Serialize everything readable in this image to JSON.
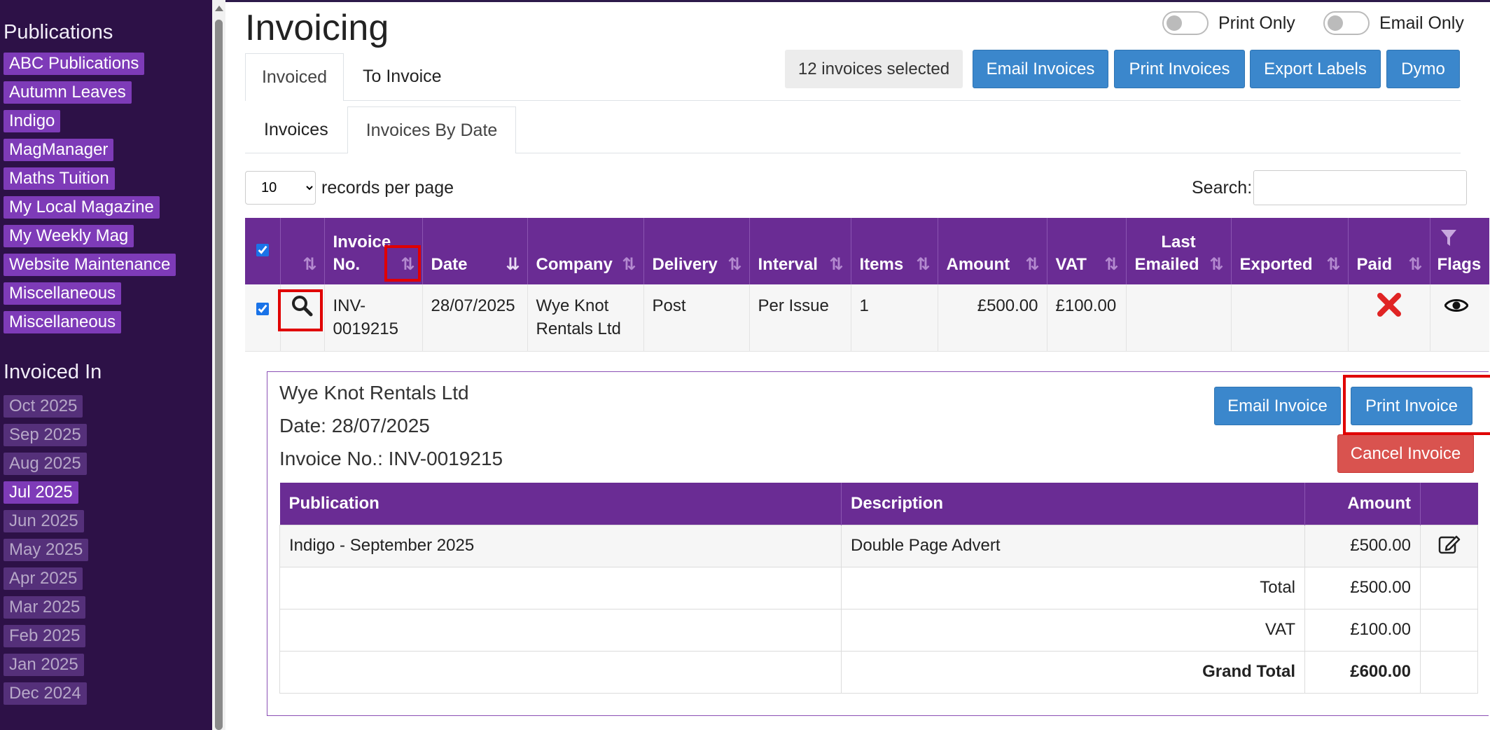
{
  "sidebar": {
    "publications_heading": "Publications",
    "publications": [
      "ABC Publications",
      "Autumn Leaves",
      "Indigo",
      "MagManager",
      "Maths Tuition",
      "My Local Magazine",
      "My Weekly Mag",
      "Website Maintenance",
      "Miscellaneous",
      "Miscellaneous"
    ],
    "invoiced_in_heading": "Invoiced In",
    "months": [
      "Oct 2025",
      "Sep 2025",
      "Aug 2025",
      "Jul 2025",
      "Jun 2025",
      "May 2025",
      "Apr 2025",
      "Mar 2025",
      "Feb 2025",
      "Jan 2025",
      "Dec 2024"
    ],
    "active_month": "Jul 2025"
  },
  "header": {
    "title": "Invoicing",
    "print_only_label": "Print Only",
    "email_only_label": "Email Only",
    "selected_count": "12 invoices selected",
    "buttons": {
      "email_invoices": "Email Invoices",
      "print_invoices": "Print Invoices",
      "export_labels": "Export Labels",
      "dymo": "Dymo"
    }
  },
  "tabs_top": [
    {
      "label": "Invoiced",
      "active": true
    },
    {
      "label": "To Invoice",
      "active": false
    }
  ],
  "tabs_sub": [
    {
      "label": "Invoices",
      "active": false
    },
    {
      "label": "Invoices By Date",
      "active": true
    }
  ],
  "records": {
    "value": "10",
    "label": "records per page"
  },
  "search": {
    "label": "Search:",
    "value": ""
  },
  "table": {
    "columns": {
      "invoice_no_line1": "Invoice",
      "invoice_no_line2": "No.",
      "date": "Date",
      "company": "Company",
      "delivery": "Delivery",
      "interval": "Interval",
      "items": "Items",
      "amount": "Amount",
      "vat": "VAT",
      "last_emailed_line1": "Last",
      "last_emailed_line2": "Emailed",
      "exported": "Exported",
      "paid": "Paid",
      "flags": "Flags"
    },
    "row": {
      "invoice_no_line1": "INV-",
      "invoice_no_line2": "0019215",
      "date": "28/07/2025",
      "company_line1": "Wye Knot",
      "company_line2": "Rentals Ltd",
      "delivery": "Post",
      "interval": "Per Issue",
      "items": "1",
      "amount": "£500.00",
      "vat": "£100.00",
      "last_emailed": "",
      "exported": ""
    }
  },
  "detail": {
    "company": "Wye Knot Rentals Ltd",
    "date_line": "Date: 28/07/2025",
    "invoice_line": "Invoice No.: INV-0019215",
    "email_button": "Email Invoice",
    "print_button": "Print Invoice",
    "cancel_button": "Cancel Invoice",
    "columns": {
      "publication": "Publication",
      "description": "Description",
      "amount": "Amount"
    },
    "line_item": {
      "publication": "Indigo - September 2025",
      "description": "Double Page Advert",
      "amount": "£500.00"
    },
    "totals": [
      {
        "label": "Total",
        "value": "£500.00"
      },
      {
        "label": "VAT",
        "value": "£100.00"
      },
      {
        "label": "Grand Total",
        "value": "£600.00"
      }
    ]
  },
  "colors": {
    "sidebar_bg": "#2d1147",
    "tag": "#7e3bb8",
    "table_header": "#6a2c94",
    "primary_button": "#3b87cc",
    "danger_button": "#d9534f",
    "highlight": "#e00000"
  }
}
